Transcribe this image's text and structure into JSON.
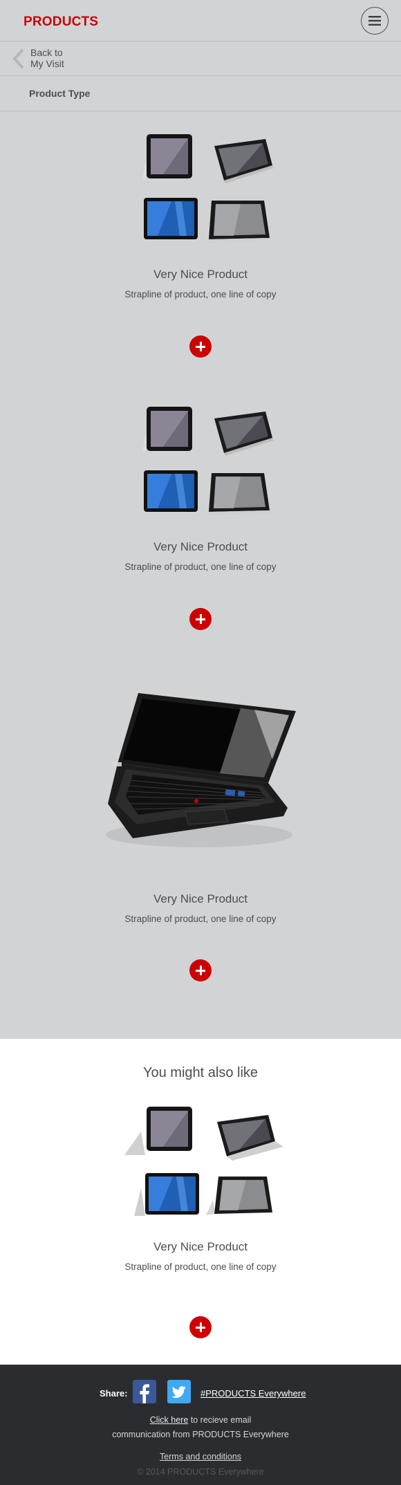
{
  "header": {
    "brand": "PRODUCTS",
    "menu_icon": "hamburger-menu-icon"
  },
  "back": {
    "line1": "Back to",
    "line2": "My Visit"
  },
  "section_title": "Product Type",
  "products": [
    {
      "name": "Very Nice Product",
      "strapline": "Strapline of product, one line of copy",
      "image": "tablets"
    },
    {
      "name": "Very Nice Product",
      "strapline": "Strapline of product, one line of copy",
      "image": "tablets"
    },
    {
      "name": "Very Nice Product",
      "strapline": "Strapline of product, one line of copy",
      "image": "laptop"
    }
  ],
  "also_like": {
    "title": "You might also like",
    "product": {
      "name": "Very Nice Product",
      "strapline": "Strapline of product, one line of copy",
      "image": "tablets"
    }
  },
  "footer": {
    "share_label": "Share:",
    "hashtag": "#PRODUCTS Everywhere",
    "click_here": "Click here",
    "email_rest1": " to recieve email",
    "email_line2": "communication from PRODUCTS Everywhere",
    "terms": "Terms and conditions",
    "copyright": "© 2014 PRODUCTS Everywhere"
  },
  "colors": {
    "accent": "#cc0000",
    "background": "#d1d3d5",
    "footer": "#2a2c30"
  }
}
